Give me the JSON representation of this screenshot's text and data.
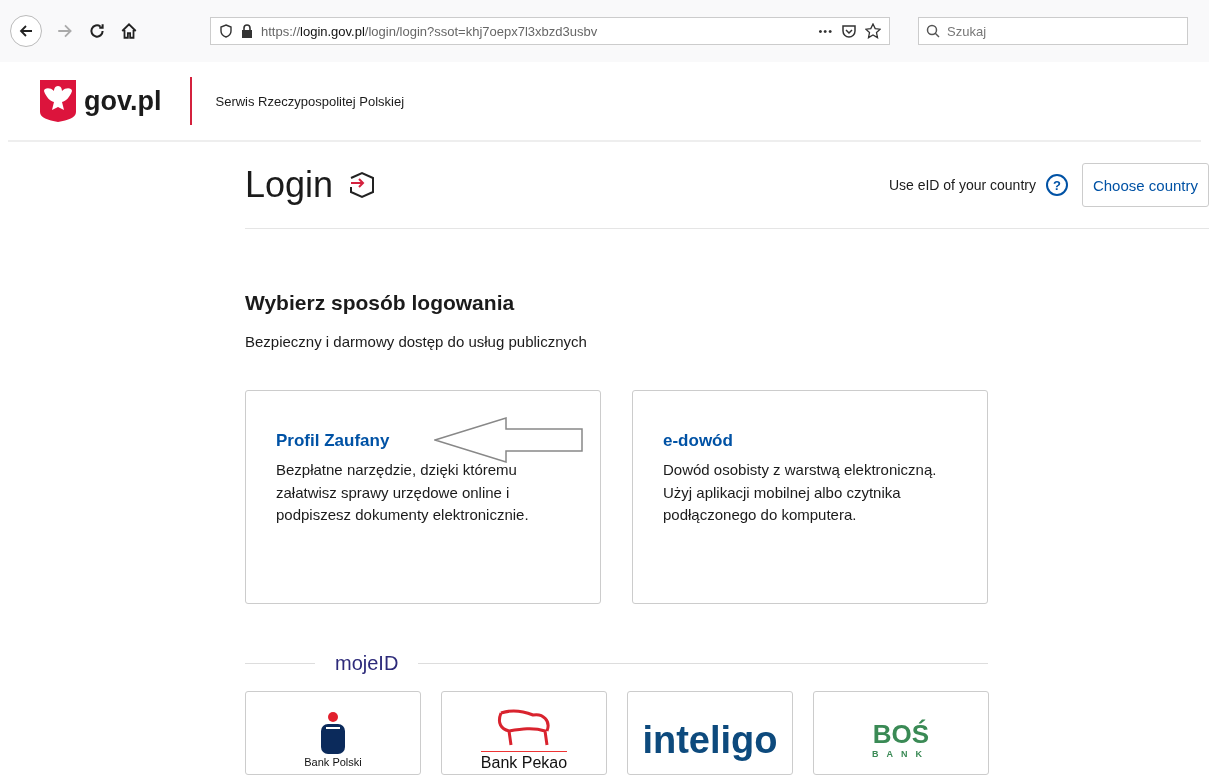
{
  "browser": {
    "url_prefix": "https://",
    "url_domain": "login.gov.pl",
    "url_path": "/login/login?ssot=khj7oepx7l3xbzd3usbv",
    "menu_dots": "•••",
    "search": {
      "placeholder": "Szukaj"
    }
  },
  "header": {
    "logo_text": "gov.pl",
    "site_name": "Serwis Rzeczypospolitej Polskiej"
  },
  "login_bar": {
    "title": "Login",
    "eid_label": "Use eID of your country",
    "help": "?",
    "country_button": "Choose country"
  },
  "heading": "Wybierz sposób logowania",
  "subtitle": "Bezpieczny i darmowy dostęp do usług publicznych",
  "methods": [
    {
      "title": "Profil Zaufany",
      "description": "Bezpłatne narzędzie, dzięki któremu załatwisz sprawy urzędowe online i podpiszesz dokumenty elektronicznie.",
      "pointer_arrow": true
    },
    {
      "title": "e-dowód",
      "description": "Dowód osobisty z warstwą elektroniczną. Użyj aplikacji mobilnej albo czytnika podłączonego do komputera.",
      "pointer_arrow": false
    }
  ],
  "mojeid": {
    "label": "mojeID",
    "banks": [
      {
        "kind": "pko",
        "text": "Bank Polski"
      },
      {
        "kind": "pekao",
        "text": "Bank Pekao"
      },
      {
        "kind": "inteligo",
        "text": "inteligo"
      },
      {
        "kind": "bos",
        "text": "BOŚ",
        "subtext": "BANK"
      }
    ]
  }
}
